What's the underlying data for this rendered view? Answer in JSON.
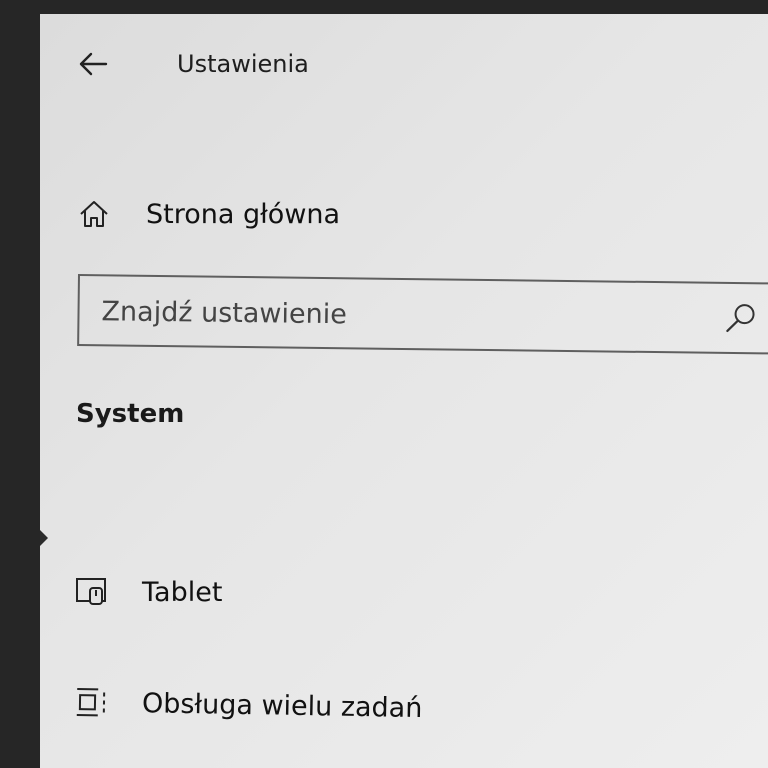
{
  "window": {
    "title": "Ustawienia"
  },
  "home": {
    "label": "Strona główna",
    "icon": "home-icon"
  },
  "search": {
    "placeholder": "Znajdź ustawienie",
    "icon": "search-icon"
  },
  "section": {
    "heading": "System"
  },
  "nav": {
    "items": [
      {
        "label": "Tablet",
        "icon": "tablet-icon"
      },
      {
        "label": "Obsługa wielu zadań",
        "icon": "multitasking-icon"
      }
    ]
  },
  "colors": {
    "background": "#e6e6e6",
    "text": "#1e1e1e",
    "border": "#5f5f5f"
  }
}
